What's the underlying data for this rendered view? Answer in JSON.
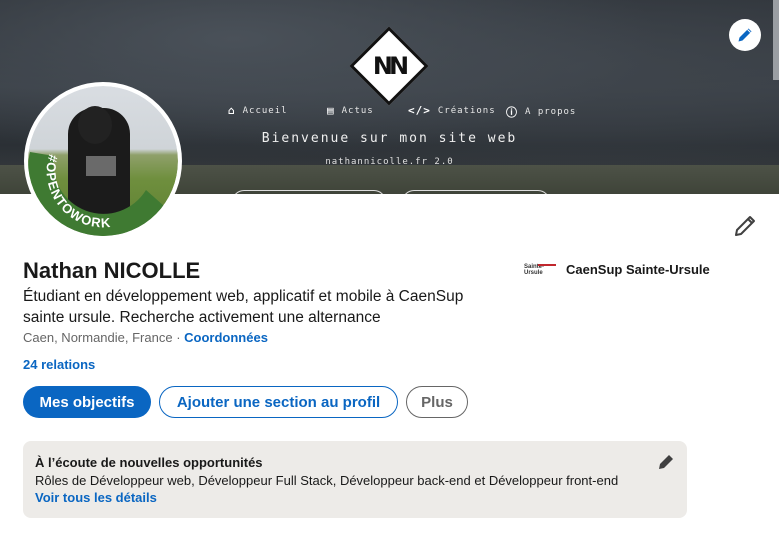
{
  "banner": {
    "site_logo_text": "NN",
    "nav": [
      {
        "icon": "home-icon",
        "glyph": "⌂",
        "label": "Accueil"
      },
      {
        "icon": "newspaper-icon",
        "glyph": "▤",
        "label": "Actus"
      },
      {
        "icon": "code-icon",
        "glyph": "</>",
        "label": "Créations"
      },
      {
        "icon": "info-icon",
        "glyph": "ⓘ",
        "label": "A propos"
      }
    ],
    "site_title": "Bienvenue sur mon site web",
    "site_subtitle": "nathannicolle.fr 2.0"
  },
  "avatar": {
    "badge_text": "#OPENTOWORK",
    "badge_color": "#3f7a32"
  },
  "profile": {
    "name": "Nathan NICOLLE",
    "headline": "Étudiant en développement web, applicatif et mobile à CaenSup sainte ursule. Recherche activement une alternance",
    "location": "Caen, Normandie, France",
    "separator": " · ",
    "contact_link": "Coordonnées",
    "relations": "24 relations",
    "school_logo_text": "Sainte-Ursule",
    "school_name": "CaenSup Sainte-Ursule"
  },
  "actions": {
    "primary": "Mes objectifs",
    "secondary": "Ajouter une section au profil",
    "more": "Plus"
  },
  "open_to_work": {
    "title": "À l’écoute de nouvelles opportunités",
    "roles": "Rôles de Développeur web, Développeur Full Stack, Développeur back-end et Développeur front-end",
    "link": "Voir tous les détails"
  },
  "colors": {
    "accent": "#0a66c2",
    "card_bg": "#edebe8"
  }
}
